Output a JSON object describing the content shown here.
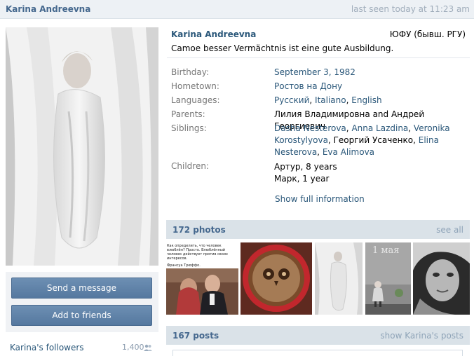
{
  "topbar": {
    "name": "Karina Andreevna",
    "last_seen": "last seen today at 11:23 am"
  },
  "sidebar": {
    "send_message": "Send a message",
    "add_friends": "Add to friends",
    "followers_label": "Karina's followers",
    "followers_count": "1,400"
  },
  "profile": {
    "name": "Karina Andreevna",
    "university": "ЮФУ (бывш. РГУ)",
    "status": "Camoe besser Vermächtnis ist eine gute Ausbildung.",
    "fields": {
      "birthday": {
        "label": "Birthday:",
        "value": "September 3, 1982"
      },
      "hometown": {
        "label": "Hometown:",
        "value": "Ростов на Дону"
      },
      "languages": {
        "label": "Languages:",
        "values": [
          "Русский",
          "Italiano",
          "English"
        ]
      },
      "parents": {
        "label": "Parents:",
        "value": "Лилия Владимировна and Андрей Георгиевич"
      },
      "siblings": {
        "label": "Siblings:",
        "people": [
          "Dasha Nesterova",
          "Anna Lazdina",
          "Veronika Korostylyova",
          "Георгий Усаченко",
          "Elina Nesterova",
          "Eva Alimova"
        ]
      },
      "children": {
        "label": "Children:",
        "items": [
          "Артур, 8 years",
          "Марк, 1 year"
        ]
      }
    },
    "show_full": "Show full information"
  },
  "photos": {
    "title": "172 photos",
    "see_all": "see all",
    "thumb1_caption": "Как определить, что человек влюблён? Просто. Влюблённый человек действует против своих интересов.",
    "thumb1_author": "Франсуа Трюффо.",
    "thumb4_text": "1 мая"
  },
  "posts": {
    "title": "167 posts",
    "show_link": "show Karina's posts"
  }
}
